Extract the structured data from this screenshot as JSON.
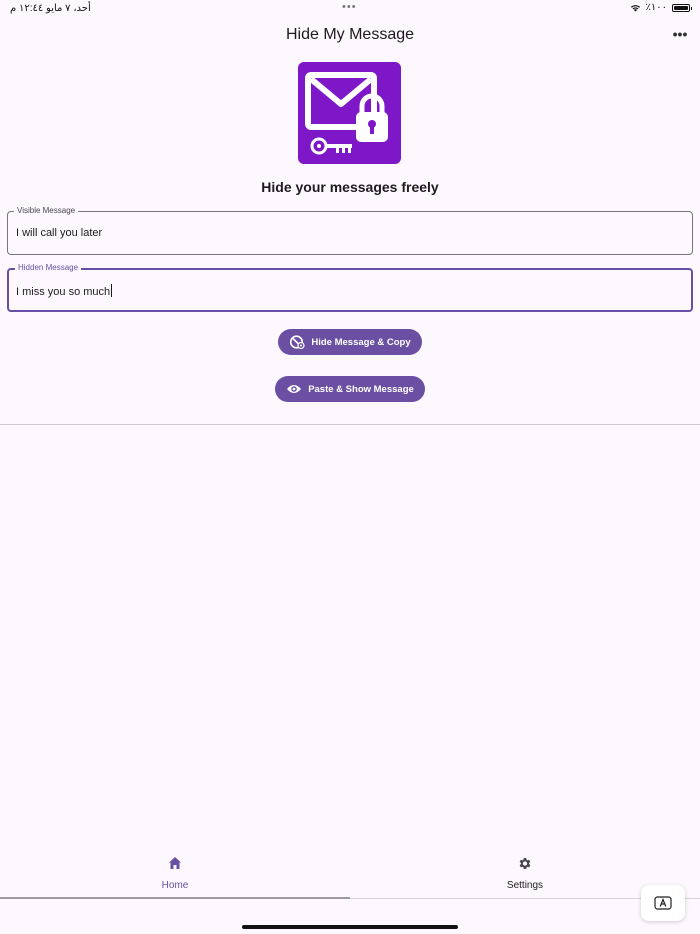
{
  "status_bar": {
    "time_date": "أحد، ٧ مايو  ١٢:٤٤ م",
    "center_dots": "•••",
    "battery_percent": "٪١٠٠"
  },
  "app": {
    "title": "Hide My Message",
    "more_label": "•••",
    "tagline": "Hide your messages freely"
  },
  "fields": {
    "visible": {
      "label": "Visible Message",
      "value": "I will call you later"
    },
    "hidden": {
      "label": "Hidden Message",
      "value": "I miss you so much"
    }
  },
  "buttons": {
    "hide_copy": "Hide Message & Copy",
    "paste_show": "Paste & Show Message"
  },
  "bottom_nav": {
    "items": [
      {
        "label": "Home",
        "icon": "home-icon",
        "selected": true
      },
      {
        "label": "Settings",
        "icon": "gear-icon",
        "selected": false
      }
    ]
  },
  "colors": {
    "primary": "#6750a4",
    "button": "#6a4fa3",
    "logo_bg": "#7d17c7",
    "background": "#fdf8fd"
  }
}
